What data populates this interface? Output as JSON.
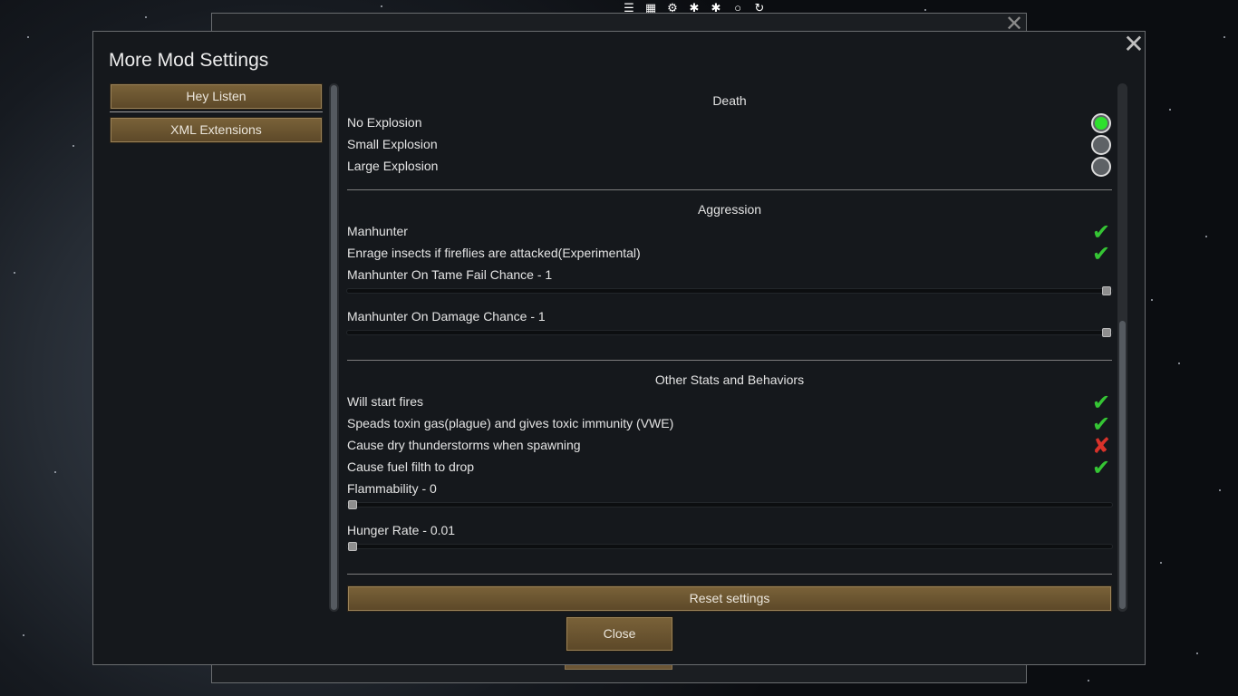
{
  "window": {
    "title": "More Mod Settings",
    "close_icon": "close-icon"
  },
  "mod_list": [
    {
      "label": "Hey Listen"
    },
    {
      "label": "XML Extensions"
    }
  ],
  "sections": {
    "death": {
      "title": "Death",
      "options": [
        {
          "label": "No Explosion",
          "selected": true
        },
        {
          "label": "Small Explosion",
          "selected": false
        },
        {
          "label": "Large Explosion",
          "selected": false
        }
      ]
    },
    "aggression": {
      "title": "Aggression",
      "toggles": [
        {
          "label": "Manhunter",
          "value": true
        },
        {
          "label": "Enrage insects if fireflies are attacked(Experimental)",
          "value": true
        }
      ],
      "sliders": [
        {
          "label": "Manhunter On Tame Fail Chance - 1",
          "value": 1
        },
        {
          "label": "Manhunter On Damage Chance - 1",
          "value": 1
        }
      ]
    },
    "other": {
      "title": "Other Stats and Behaviors",
      "toggles": [
        {
          "label": "Will start fires",
          "value": true
        },
        {
          "label": "Speads toxin gas(plague) and gives toxic immunity (VWE)",
          "value": true
        },
        {
          "label": "Cause dry thunderstorms when spawning",
          "value": false
        },
        {
          "label": "Cause fuel filth to drop",
          "value": true
        }
      ],
      "sliders": [
        {
          "label": "Flammability - 0",
          "value": 0
        },
        {
          "label": "Hunger Rate - 0.01",
          "value": 0
        }
      ]
    }
  },
  "reset_label": "Reset settings",
  "close_label": "Close",
  "colors": {
    "button": "#7a6239",
    "check": "#35c534",
    "cross": "#d9322a",
    "radio_on": "#2ee02e"
  }
}
